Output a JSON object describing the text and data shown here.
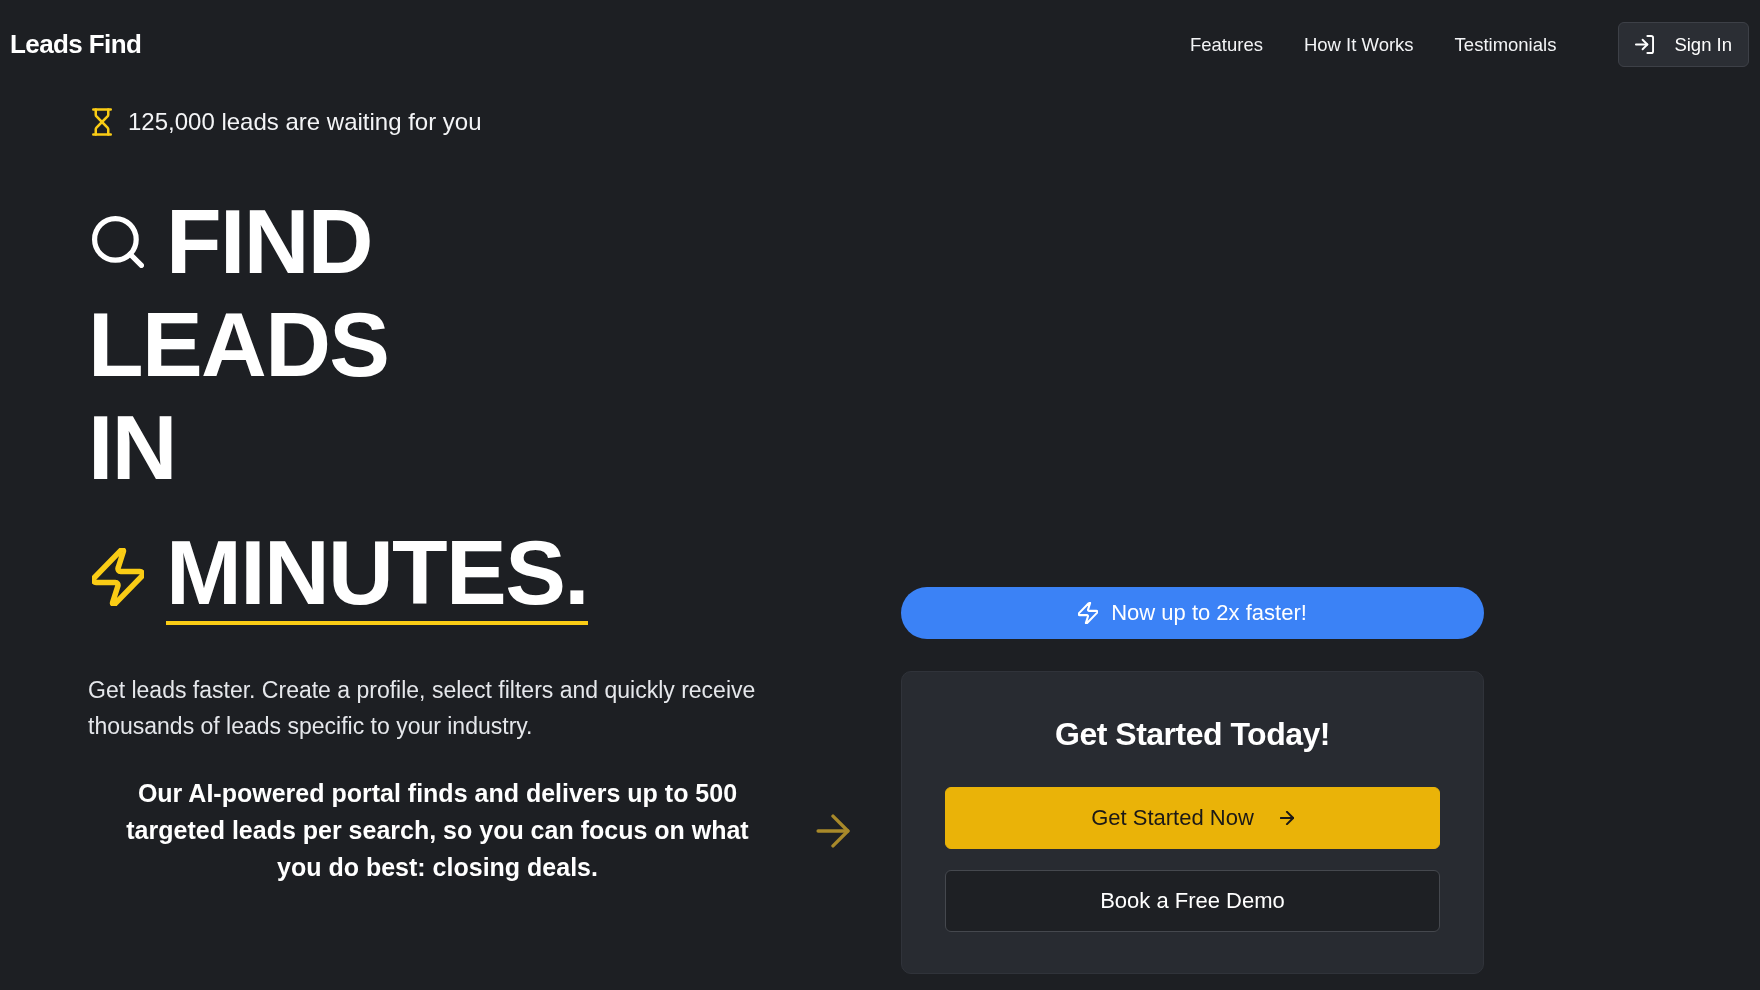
{
  "header": {
    "logo": "Leads Find",
    "nav": [
      "Features",
      "How It Works",
      "Testimonials"
    ],
    "sign_in": "Sign In"
  },
  "hero": {
    "badge": "125,000 leads are waiting for you",
    "headline": [
      {
        "text": "FIND",
        "highlight": false
      },
      {
        "text": "LEADS",
        "highlight": false
      },
      {
        "text": "IN",
        "highlight": false
      },
      {
        "text": "MINUTES.",
        "highlight": true
      }
    ],
    "intro": "Get leads faster. Create a profile, select filters and quickly receive thousands of leads specific to your industry.",
    "pitch": "Our AI-powered portal finds and delivers up to 500 targeted leads per search, so you can focus on what you do best: closing deals."
  },
  "promo": {
    "label": "Now up to 2x faster!"
  },
  "card": {
    "title": "Get Started Today!",
    "buttons": [
      {
        "label": "Get Started Now",
        "kind": "primary"
      },
      {
        "label": "Book a Free Demo",
        "kind": "secondary"
      }
    ]
  }
}
